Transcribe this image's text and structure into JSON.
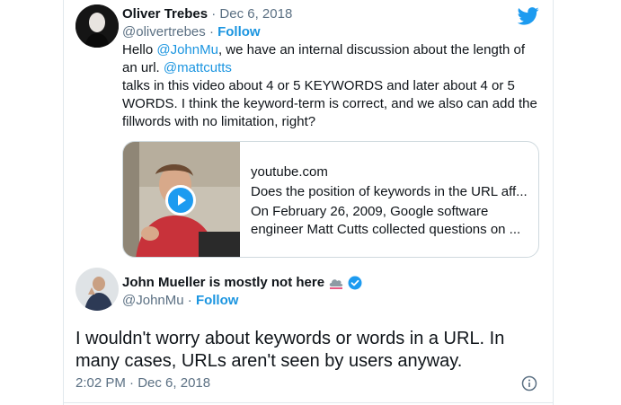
{
  "tweet1": {
    "author_name": "Oliver Trebes",
    "separator": "·",
    "date": "Dec 6, 2018",
    "handle": "@olivertrebes",
    "follow_sep": "·",
    "follow_label": "Follow",
    "body": {
      "line1_pre": "Hello ",
      "line1_mention": "@JohnMu",
      "line1_post": ", we have an internal discussion about the length of",
      "line2_pre": "an url. ",
      "line2_mention": "@mattcutts",
      "line3": "talks in this video about 4 or 5 KEYWORDS and later about 4 or 5",
      "line4": "WORDS. I think  the keyword-term is correct, and we also can add the",
      "line5": "fillwords with no limitation, right?"
    },
    "card": {
      "domain": "youtube.com",
      "title": "Does the position of keywords in the URL aff...",
      "desc_line1": "On February 26, 2009, Google software",
      "desc_line2": "engineer Matt Cutts collected questions on ..."
    }
  },
  "tweet2": {
    "author_name": "John Mueller is mostly not here",
    "handle": "@JohnMu",
    "follow_sep": "·",
    "follow_label": "Follow",
    "body_line1": "I wouldn't worry about keywords or words in a URL. In",
    "body_line2": "many cases, URLs aren't seen by users anyway.",
    "time": "2:02 PM",
    "time_sep": "·",
    "date": "Dec 6, 2018"
  },
  "icons": {
    "brand": "twitter-bird-icon",
    "verified": "verified-badge-icon",
    "cloud": "cloud-emoji-icon",
    "info": "info-icon",
    "play": "play-icon"
  },
  "colors": {
    "link": "#1b95e0",
    "twitter_blue": "#1d9bf0",
    "muted": "#5b7083",
    "text": "#0f1419"
  }
}
